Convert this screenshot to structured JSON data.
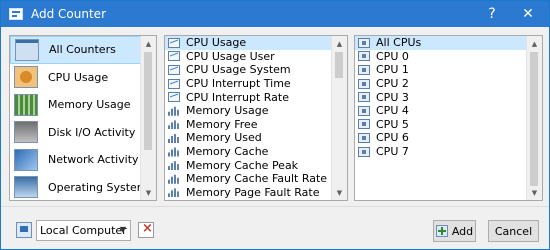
{
  "window": {
    "title": "Add Counter",
    "help_label": "?",
    "close_label": "✕"
  },
  "categories": [
    {
      "label": "All Counters",
      "icon": "all-counters-icon",
      "selected": true
    },
    {
      "label": "CPU Usage",
      "icon": "cpu-chip-icon"
    },
    {
      "label": "Memory Usage",
      "icon": "memory-icon"
    },
    {
      "label": "Disk I/O Activity",
      "icon": "disk-icon"
    },
    {
      "label": "Network Activity",
      "icon": "network-icon"
    },
    {
      "label": "Operating System",
      "icon": "os-icon"
    }
  ],
  "counters": [
    {
      "label": "CPU Usage",
      "icon": "chart",
      "selected": true
    },
    {
      "label": "CPU Usage User",
      "icon": "chart"
    },
    {
      "label": "CPU Usage System",
      "icon": "chart"
    },
    {
      "label": "CPU Interrupt Time",
      "icon": "chart"
    },
    {
      "label": "CPU Interrupt Rate",
      "icon": "chart"
    },
    {
      "label": "Memory Usage",
      "icon": "bars"
    },
    {
      "label": "Memory Free",
      "icon": "bars"
    },
    {
      "label": "Memory Used",
      "icon": "bars"
    },
    {
      "label": "Memory Cache",
      "icon": "bars"
    },
    {
      "label": "Memory Cache Peak",
      "icon": "bars"
    },
    {
      "label": "Memory Cache Fault Rate",
      "icon": "bars"
    },
    {
      "label": "Memory Page Fault Rate",
      "icon": "bars"
    }
  ],
  "instances": [
    {
      "label": "All CPUs",
      "selected": true
    },
    {
      "label": "CPU 0"
    },
    {
      "label": "CPU 1"
    },
    {
      "label": "CPU 2"
    },
    {
      "label": "CPU 3"
    },
    {
      "label": "CPU 4"
    },
    {
      "label": "CPU 5"
    },
    {
      "label": "CPU 6"
    },
    {
      "label": "CPU 7"
    }
  ],
  "footer": {
    "computer_select_value": "Local Computer",
    "add_label": "Add",
    "cancel_label": "Cancel"
  },
  "colors": {
    "titlebar": "#2b79d0",
    "selection": "#cce8ff"
  }
}
